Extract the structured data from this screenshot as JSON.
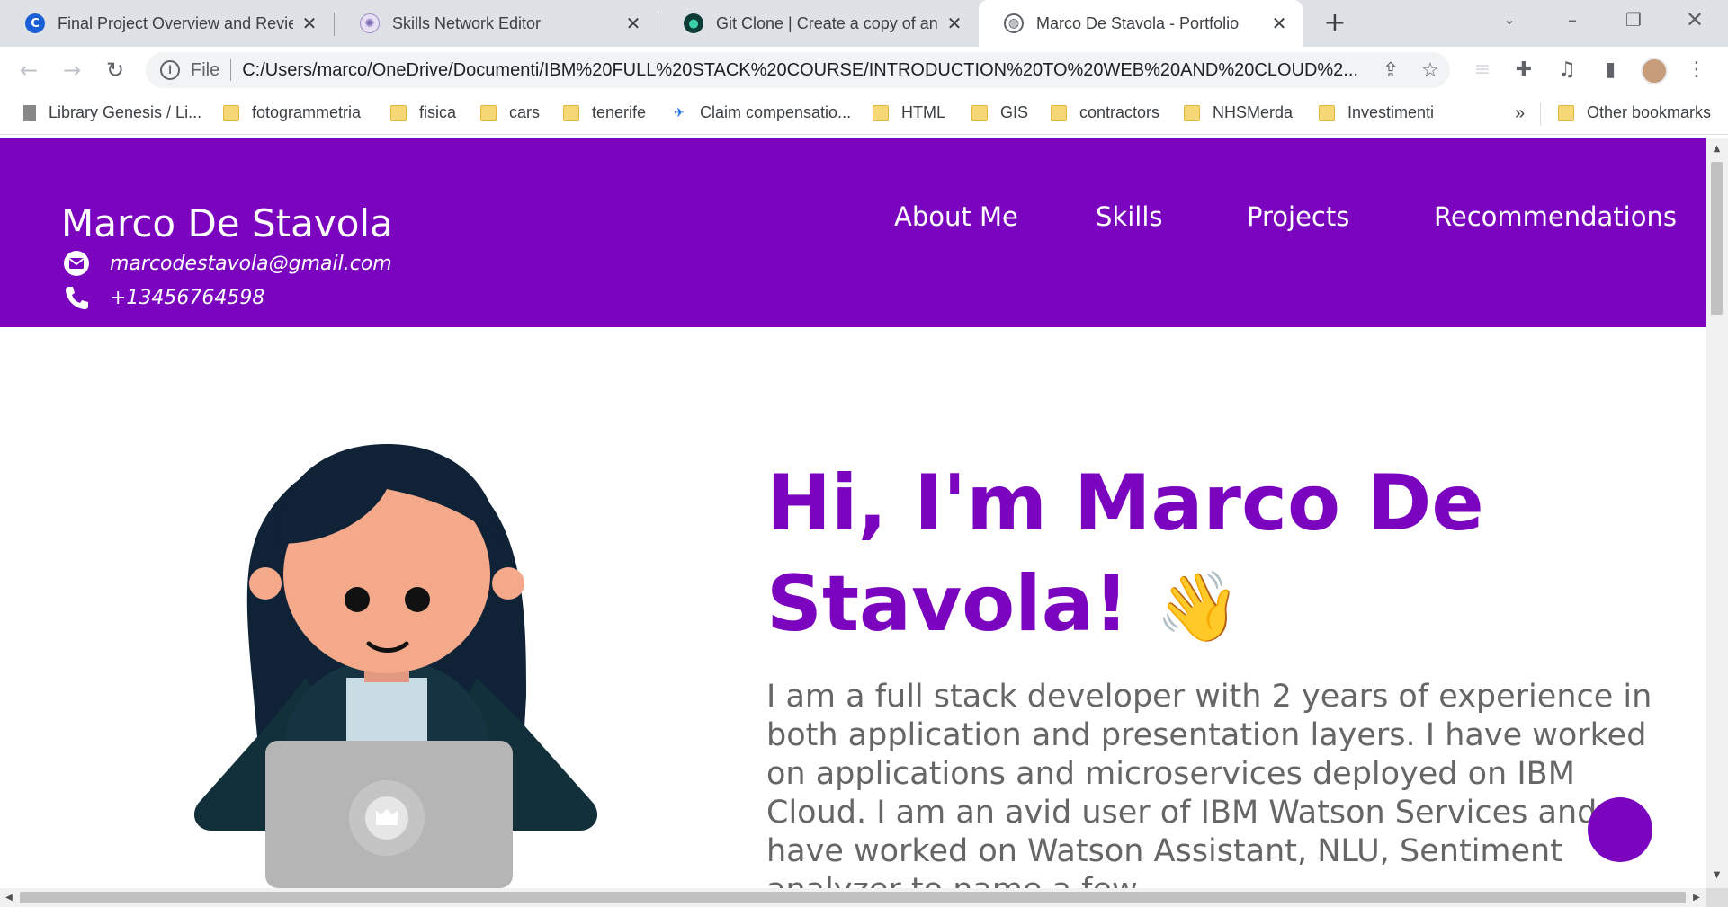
{
  "browser": {
    "tabs": [
      {
        "title": "Final Project Overview and Review",
        "active": false
      },
      {
        "title": "Skills Network Editor",
        "active": false
      },
      {
        "title": "Git Clone | Create a copy of an existing repository",
        "active": false
      },
      {
        "title": "Marco De Stavola - Portfolio",
        "active": true
      }
    ],
    "address": {
      "scheme": "File",
      "url": "C:/Users/marco/OneDrive/Documenti/IBM%20FULL%20STACK%20COURSE/INTRODUCTION%20TO%20WEB%20AND%20CLOUD%2..."
    },
    "bookmarks": [
      {
        "label": "Library Genesis / Li...",
        "icon": "book-icon"
      },
      {
        "label": "fotogrammetria",
        "icon": "folder-icon"
      },
      {
        "label": "fisica",
        "icon": "folder-icon"
      },
      {
        "label": "cars",
        "icon": "folder-icon"
      },
      {
        "label": "tenerife",
        "icon": "folder-icon"
      },
      {
        "label": "Claim compensatio...",
        "icon": "plane-icon"
      },
      {
        "label": "HTML",
        "icon": "folder-icon"
      },
      {
        "label": "GIS",
        "icon": "folder-icon"
      },
      {
        "label": "contractors",
        "icon": "folder-icon"
      },
      {
        "label": "NHSMerda",
        "icon": "folder-icon"
      },
      {
        "label": "Investimenti",
        "icon": "folder-icon"
      }
    ],
    "bookmarks_overflow": "»",
    "other_bookmarks": "Other bookmarks"
  },
  "page": {
    "header": {
      "name": "Marco De Stavola",
      "email": "marcodestavola@gmail.com",
      "phone": "+13456764598",
      "nav": [
        "About Me",
        "Skills",
        "Projects",
        "Recommendations"
      ]
    },
    "hero": {
      "title_line1": "Hi, I'm Marco De",
      "title_line2": "Stavola!",
      "wave": "👋",
      "intro": "I am a full stack developer with 2 years of experience in both application and presentation layers. I have worked on applications and microservices deployed on IBM Cloud. I am an avid user of IBM Watson Services and have worked on Watson Assistant, NLU, Sentiment analyzer to name a few."
    }
  },
  "colors": {
    "brand": "#7b05bf",
    "body_text": "#666666",
    "header_text": "#ffffff"
  }
}
